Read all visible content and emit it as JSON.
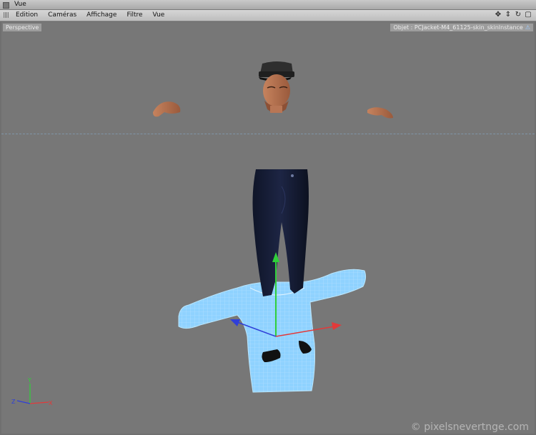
{
  "window": {
    "title": "Vue"
  },
  "menu": [
    "Edition",
    "Caméras",
    "Affichage",
    "Filtre",
    "Vue"
  ],
  "nav_icons": [
    "move-icon",
    "zoom-icon",
    "rotate-icon",
    "maximize-icon"
  ],
  "viewport": {
    "camera_label": "Perspective",
    "object_label": "Objet : PCJacket-M4_61125-skin_skinInstance"
  },
  "axes": {
    "x": "X",
    "y": "Y",
    "z": "Z"
  },
  "watermark": "© pixelsnevertnge.com",
  "colors": {
    "background": "#777777",
    "wireframe": "#8fd2ff",
    "pants": "#141b33",
    "axis_x": "#e23a3a",
    "axis_y": "#2fcf3a",
    "axis_z": "#2f3fd8"
  }
}
